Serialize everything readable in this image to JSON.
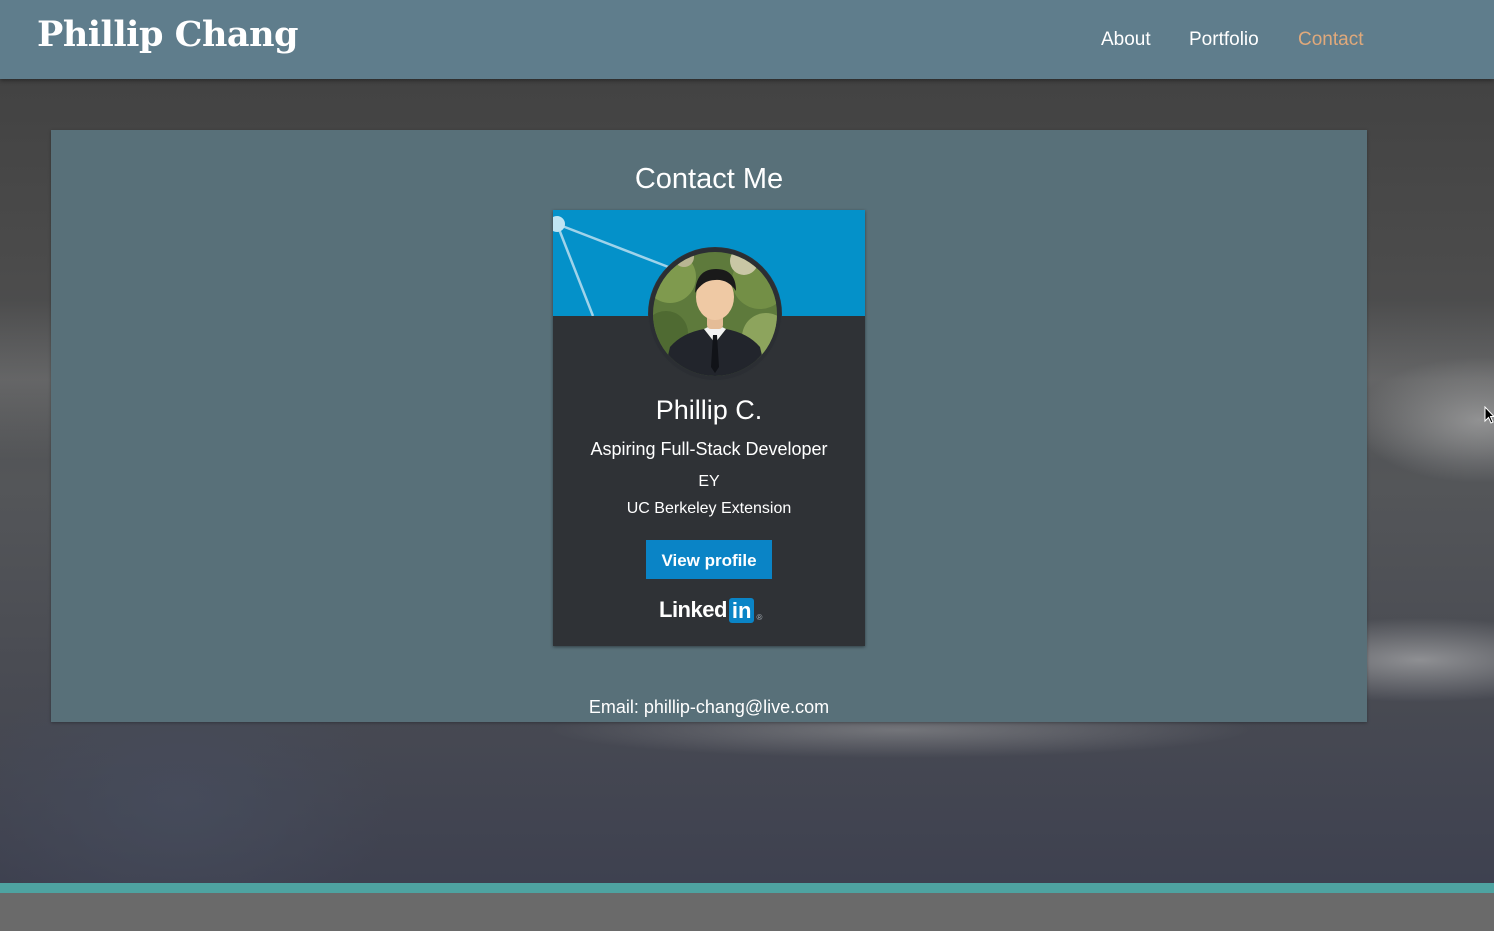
{
  "header": {
    "brand": "Phillip Chang",
    "nav": [
      {
        "label": "About"
      },
      {
        "label": "Portfolio"
      },
      {
        "label": "Contact",
        "active": true
      }
    ]
  },
  "contact": {
    "title": "Contact Me",
    "email_line": "Email: phillip-chang@live.com"
  },
  "card": {
    "name": "Phillip C.",
    "headline": "Aspiring Full-Stack Developer",
    "company": "EY",
    "school": "UC Berkeley Extension",
    "button_label": "View profile",
    "logo_word": "Linked",
    "logo_box": "in",
    "logo_mark": "®"
  },
  "colors": {
    "header_bg": "#5f7d8c",
    "panel_bg": "#587079",
    "card_bg": "#2f3236",
    "banner_blue": "#0491c9",
    "button_blue": "#0a84c6",
    "nav_active": "#e0a97b",
    "teal_bar": "#4ea3a1"
  },
  "icons": {
    "profile_photo": "person-avatar",
    "cursor": "mouse-pointer-icon"
  }
}
